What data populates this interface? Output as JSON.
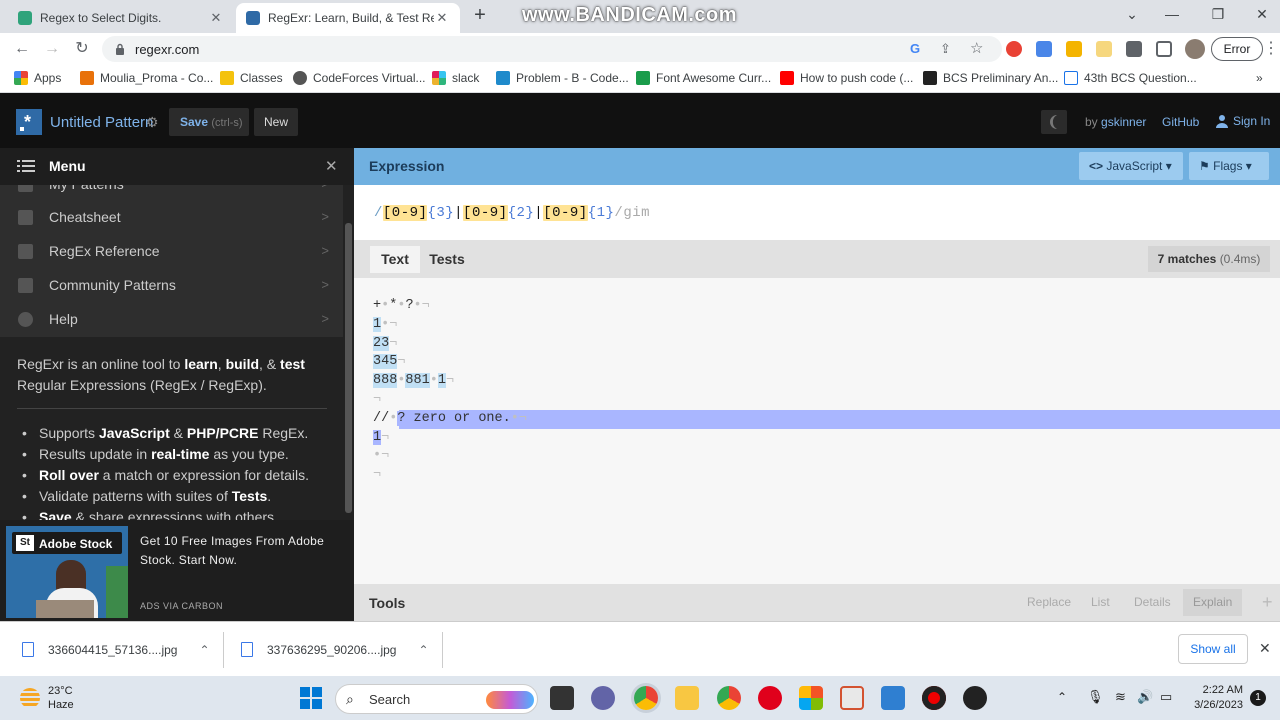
{
  "browser": {
    "tabs": [
      {
        "title": "Regex to Select Digits.",
        "close": "✕"
      },
      {
        "title": "RegExr: Learn, Build, & Test RegEx",
        "close": "✕"
      }
    ],
    "new_tab": "+",
    "watermark": "www.BANDICAM.com",
    "url": "regexr.com",
    "error_label": "Error",
    "bookmarks": [
      "Apps",
      "Moulia_Proma - Co...",
      "Classes",
      "CodeForces Virtual...",
      "slack",
      "Problem - B - Code...",
      "Font Awesome Curr...",
      "How to push code (...",
      "BCS Preliminary An...",
      "43th BCS Question..."
    ],
    "bookmarks_more": "»",
    "colors": {
      "tabbar": "#dee1e6",
      "omnibox": "#f1f3f4"
    }
  },
  "header": {
    "title": "Untitled Pattern",
    "save_label": "Save",
    "save_hint": "(ctrl-s)",
    "new_label": "New",
    "by_label": "by",
    "user": "gskinner",
    "github": "GitHub",
    "signin": "Sign In"
  },
  "menu": {
    "title": "Menu",
    "items": [
      {
        "label": "My Patterns",
        "icon": "folder-icon"
      },
      {
        "label": "Cheatsheet",
        "icon": "document-icon"
      },
      {
        "label": "RegEx Reference",
        "icon": "book-icon"
      },
      {
        "label": "Community Patterns",
        "icon": "users-icon"
      },
      {
        "label": "Help",
        "icon": "help-icon"
      }
    ],
    "intro": {
      "prefix": "RegExr is an online tool to ",
      "learn": "learn",
      "sep1": ", ",
      "build": "build",
      "sep2": ", & ",
      "test": "test",
      "suffix": " Regular Expressions (RegEx / RegExp)."
    },
    "features": [
      {
        "pre": "Supports ",
        "b1": "JavaScript",
        "mid": " & ",
        "b2": "PHP/PCRE",
        "post": " RegEx."
      },
      {
        "pre": "Results update in ",
        "b1": "real-time",
        "mid": "",
        "b2": "",
        "post": " as you type."
      },
      {
        "pre": "",
        "b1": "Roll over",
        "mid": "",
        "b2": "",
        "post": " a match or expression for details."
      },
      {
        "pre": "Validate patterns with suites of ",
        "b1": "Tests",
        "mid": "",
        "b2": "",
        "post": "."
      },
      {
        "pre": "",
        "b1": "Save",
        "mid": "",
        "b2": "",
        "post": " & share expressions with others."
      }
    ],
    "ad": {
      "brand": "Adobe Stock",
      "brand_mark": "St",
      "text": "Get 10 Free Images From Adobe Stock. Start Now.",
      "via": "ADS VIA CARBON"
    }
  },
  "expression": {
    "title": "Expression",
    "flavor": "JavaScript",
    "flags_label": "Flags",
    "regex_parts": [
      {
        "t": "/",
        "c": "rd"
      },
      {
        "t": "[0-9]",
        "c": "rs"
      },
      {
        "t": "{3}",
        "c": "rq"
      },
      {
        "t": "|",
        "c": "ra"
      },
      {
        "t": "[0-9]",
        "c": "rs"
      },
      {
        "t": "{2}",
        "c": "rq"
      },
      {
        "t": "|",
        "c": "ra"
      },
      {
        "t": "[0-9]",
        "c": "rs"
      },
      {
        "t": "{1}",
        "c": "rq"
      },
      {
        "t": "/gim",
        "c": "rf"
      }
    ]
  },
  "text_panel": {
    "tab_text": "Text",
    "tab_tests": "Tests",
    "matches": "7 matches",
    "time": "(0.4ms)",
    "lines": [
      [
        {
          "t": "+"
        },
        {
          "t": "•",
          "c": "hs"
        },
        {
          "t": "*"
        },
        {
          "t": "•",
          "c": "hs"
        },
        {
          "t": "?"
        },
        {
          "t": "•¬",
          "c": "hs"
        }
      ],
      [
        {
          "t": "1",
          "c": "mt"
        },
        {
          "t": "•¬",
          "c": "hs"
        }
      ],
      [
        {
          "t": "23",
          "c": "mt"
        },
        {
          "t": "¬",
          "c": "hs"
        }
      ],
      [
        {
          "t": "345",
          "c": "mt"
        },
        {
          "t": "¬",
          "c": "hs"
        }
      ],
      [
        {
          "t": "888",
          "c": "mt"
        },
        {
          "t": "•",
          "c": "hs"
        },
        {
          "t": "881",
          "c": "mt"
        },
        {
          "t": "•",
          "c": "hs"
        },
        {
          "t": "1",
          "c": "mt"
        },
        {
          "t": "¬",
          "c": "hs"
        }
      ],
      [
        {
          "t": "¬",
          "c": "hs"
        }
      ],
      [
        {
          "t": "//"
        },
        {
          "t": "•",
          "c": "hs"
        },
        {
          "t": "? zero or one.",
          "c": "sel"
        },
        {
          "t": "•¬",
          "c": "hs"
        }
      ],
      [
        {
          "t": "1",
          "c": "mt sel"
        },
        {
          "t": "¬",
          "c": "hs"
        }
      ],
      [
        {
          "t": "•¬",
          "c": "hs"
        }
      ],
      [
        {
          "t": "¬",
          "c": "hs"
        }
      ]
    ]
  },
  "tools": {
    "title": "Tools",
    "buttons": [
      "Replace",
      "List",
      "Details",
      "Explain"
    ],
    "add": "+"
  },
  "downloads": {
    "files": [
      "336604415_57136....jpg",
      "337636295_90206....jpg"
    ],
    "show_all": "Show all",
    "close": "✕"
  },
  "taskbar": {
    "temp": "23°C",
    "weather": "Haze",
    "search": "Search",
    "time": "2:22 AM",
    "date": "3/26/2023",
    "notifications": "1"
  }
}
